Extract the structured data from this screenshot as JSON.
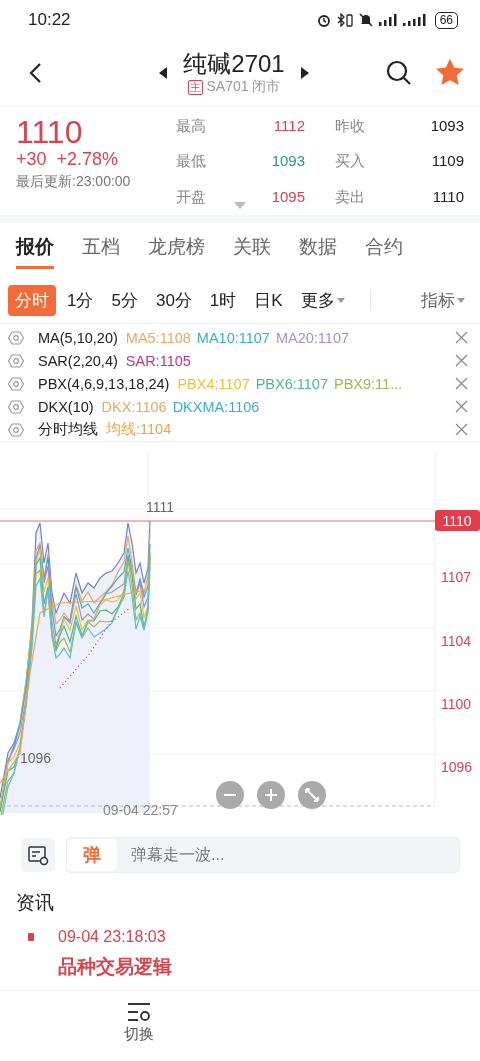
{
  "status_bar": {
    "time": "10:22",
    "battery": "66"
  },
  "header": {
    "title": "纯碱2701",
    "market_badge": "主",
    "subtitle": "SA701 闭市",
    "favorite": true
  },
  "quote": {
    "price": "1110",
    "change": "+30",
    "change_pct": "+2.78%",
    "updated": "最后更新:23:00:00",
    "color": "#d7434f",
    "stats": [
      {
        "label": "最高",
        "value": "1112",
        "color": "#d7434f"
      },
      {
        "label": "昨收",
        "value": "1093",
        "color": "#222222"
      },
      {
        "label": "最低",
        "value": "1093",
        "color": "#1b9d83"
      },
      {
        "label": "买入",
        "value": "1109",
        "color": "#222222"
      },
      {
        "label": "开盘",
        "value": "1095",
        "color": "#d7434f"
      },
      {
        "label": "卖出",
        "value": "1110",
        "color": "#222222"
      }
    ]
  },
  "tabs": [
    {
      "label": "报价",
      "selected": true
    },
    {
      "label": "五档",
      "selected": false
    },
    {
      "label": "龙虎榜",
      "selected": false
    },
    {
      "label": "关联",
      "selected": false
    },
    {
      "label": "数据",
      "selected": false
    },
    {
      "label": "合约",
      "selected": false
    }
  ],
  "periods": [
    {
      "label": "分时",
      "selected": true
    },
    {
      "label": "1分",
      "selected": false
    },
    {
      "label": "5分",
      "selected": false
    },
    {
      "label": "30分",
      "selected": false
    },
    {
      "label": "1时",
      "selected": false
    },
    {
      "label": "日K",
      "selected": false
    },
    {
      "label": "更多",
      "selected": false
    }
  ],
  "indicator_button": "指标",
  "indicators": [
    {
      "name": "MA(5,10,20)",
      "values": [
        {
          "text": "MA5:1108",
          "color": "#e9a766"
        },
        {
          "text": "MA10:1107",
          "color": "#3aaec6"
        },
        {
          "text": "MA20:1107",
          "color": "#a38fd6"
        }
      ]
    },
    {
      "name": "SAR(2,20,4)",
      "values": [
        {
          "text": "SAR:1105",
          "color": "#c2338c"
        }
      ]
    },
    {
      "name": "PBX(4,6,9,13,18,24)",
      "values": [
        {
          "text": "PBX4:1107",
          "color": "#e6c23e"
        },
        {
          "text": "PBX6:1107",
          "color": "#4fb68e"
        },
        {
          "text": "PBX9:11...",
          "color": "#a6b54e"
        }
      ]
    },
    {
      "name": "DKX(10)",
      "values": [
        {
          "text": "DKX:1106",
          "color": "#e9a766"
        },
        {
          "text": "DKXMA:1106",
          "color": "#3aaec6"
        }
      ]
    },
    {
      "name": "分时均线",
      "values": [
        {
          "text": "均线:1104",
          "color": "#eaa548"
        }
      ]
    }
  ],
  "chart": {
    "y_labels": [
      "1107",
      "1104",
      "1100",
      "1096"
    ],
    "current_price": "1110",
    "high_marker": "1111",
    "low_marker": "1096",
    "time_label": "09-04 22:57"
  },
  "danmaku": {
    "badge": "弹",
    "placeholder": "弹幕走一波..."
  },
  "news": {
    "heading": "资讯",
    "items": [
      {
        "time": "09-04 23:18:03",
        "title": "品种交易逻辑"
      }
    ]
  },
  "bottom_nav": [
    {
      "label": "切换"
    }
  ]
}
